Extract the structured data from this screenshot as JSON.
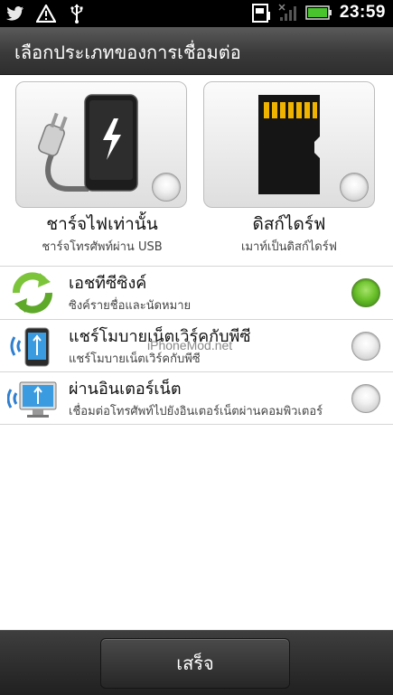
{
  "status_bar": {
    "left_icons": [
      "twitter-bird-icon",
      "warning-triangle-icon",
      "usb-icon"
    ],
    "right_icons": [
      "sd-card-status-icon",
      "signal-icon",
      "battery-icon"
    ],
    "time": "23:59"
  },
  "dialog": {
    "title": "เลือกประเภทของการเชื่อมต่อ"
  },
  "options": [
    {
      "label": "ชาร์จไฟเท่านั้น",
      "description": "ชาร์จโทรศัพท์ผ่าน USB",
      "icon": "charging-plug-icon",
      "selected": false
    },
    {
      "label": "ดิสก์ไดร์ฟ",
      "description": "เมาท์เป็นดิสก์ไดร์ฟ",
      "icon": "memory-card-icon",
      "selected": false
    }
  ],
  "list": [
    {
      "label": "เอชทีซีซิงค์",
      "description": "ซิงค์รายชื่อและนัดหมาย",
      "icon": "sync-arrows-icon",
      "selected": true
    },
    {
      "label": "แชร์โมบายเน็ตเวิร์คกับพีซี",
      "description": "แชร์โมบายเน็ตเวิร์คกับพีซี",
      "icon": "phone-usb-share-icon",
      "selected": false
    },
    {
      "label": "ผ่านอินเตอร์เน็ต",
      "description": "เชื่อมต่อโทรศัพท์ไปยังอินเตอร์เน็ตผ่านคอมพิวเตอร์",
      "icon": "monitor-usb-icon",
      "selected": false
    }
  ],
  "watermark": "iPhoneMod.net",
  "footer": {
    "done_label": "เสร็จ"
  },
  "colors": {
    "selected_radio": "#6cc22c",
    "title_bar": "#3a3a3a",
    "status_bar": "#000000"
  }
}
